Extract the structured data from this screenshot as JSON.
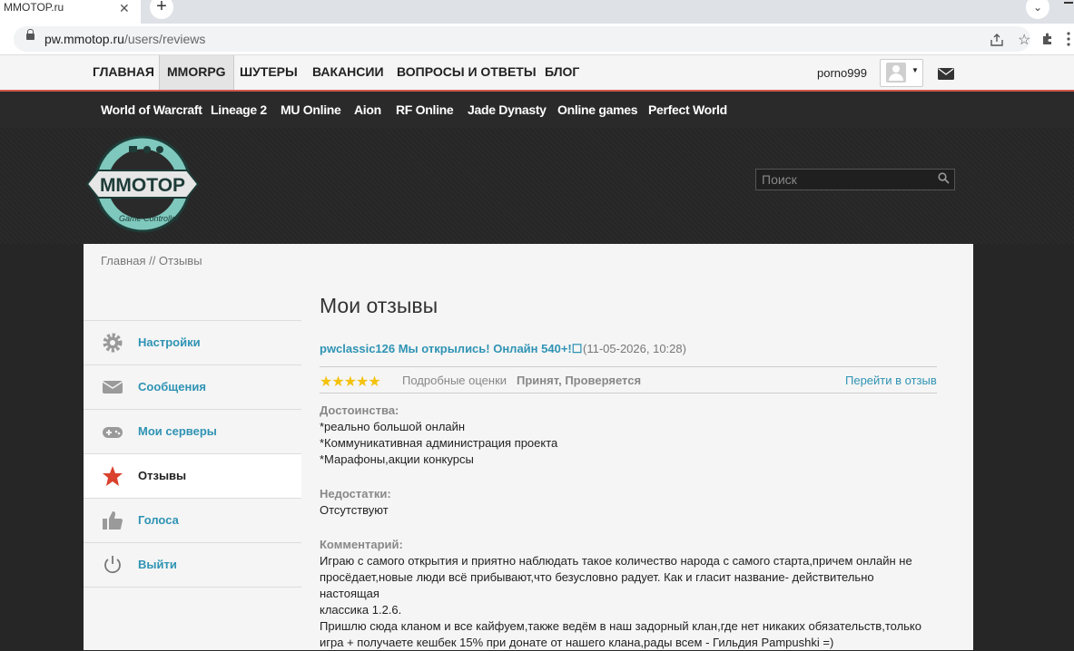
{
  "browser": {
    "tab_title": "MMOTOP.ru",
    "close_glyph": "✕",
    "new_tab_glyph": "+",
    "tab_menu_glyph": "⌄",
    "url_host": "pw.mmotop.ru",
    "url_path": "/users/reviews"
  },
  "topnav": {
    "items": [
      "ГЛАВНАЯ",
      "MMORPG",
      "ШУТЕРЫ",
      "ВАКАНСИИ",
      "ВОПРОСЫ И ОТВЕТЫ",
      "БЛОГ"
    ],
    "username": "porno999"
  },
  "games": [
    "World of Warcraft",
    "Lineage 2",
    "MU Online",
    "Aion",
    "RF Online",
    "Jade Dynasty",
    "Online games",
    "Perfect World"
  ],
  "logo": {
    "text": "MMOTOP",
    "subtext": "Game Controller"
  },
  "search": {
    "placeholder": "Поиск"
  },
  "breadcrumb": "Главная // Отзывы",
  "sidebar": {
    "items": [
      {
        "label": "Настройки",
        "icon": "gear-icon"
      },
      {
        "label": "Сообщения",
        "icon": "envelope-icon"
      },
      {
        "label": "Мои серверы",
        "icon": "gamepad-icon"
      },
      {
        "label": "Отзывы",
        "icon": "star-icon"
      },
      {
        "label": "Голоса",
        "icon": "thumbs-up-icon"
      },
      {
        "label": "Выйти",
        "icon": "power-icon"
      }
    ]
  },
  "main": {
    "heading": "Мои отзывы",
    "review": {
      "title": "pwclassic126 Мы открылись! Онлайн 540+!☐",
      "date": "(11-05-2026, 10:28)",
      "stars": "★★★★★",
      "rating": 5,
      "detailed_label": "Подробные оценки",
      "status": "Принят, Проверяется",
      "goto_label": "Перейти в отзыв",
      "pros_heading": "Достоинства:",
      "pros": [
        "*реально большой онлайн",
        "*Коммуникативная администрация проекта",
        "*Марафоны,акции конкурсы"
      ],
      "cons_heading": "Недостатки:",
      "cons": "Отсутствуют",
      "comment_heading": "Комментарий:",
      "comment": [
        "Играю с самого открытия и приятно наблюдать такое количество народа с самого старта,причем онлайн не",
        "просёдает,новые люди всё прибывают,что безусловно радует. Как и гласит название- действительно настоящая",
        "классика 1.2.6.",
        "Пришлю сюда кланом и все кайфуем,также ведём в наш задорный клан,где нет никаких обязательств,только",
        "игра + получаете кешбек 15% при донате от нашего клана,рады всем - Гильдия Pampushki =)"
      ]
    }
  },
  "colors": {
    "accent": "#2f93b4",
    "nav_rule": "#d0584c",
    "stars": "#f4c20d"
  }
}
